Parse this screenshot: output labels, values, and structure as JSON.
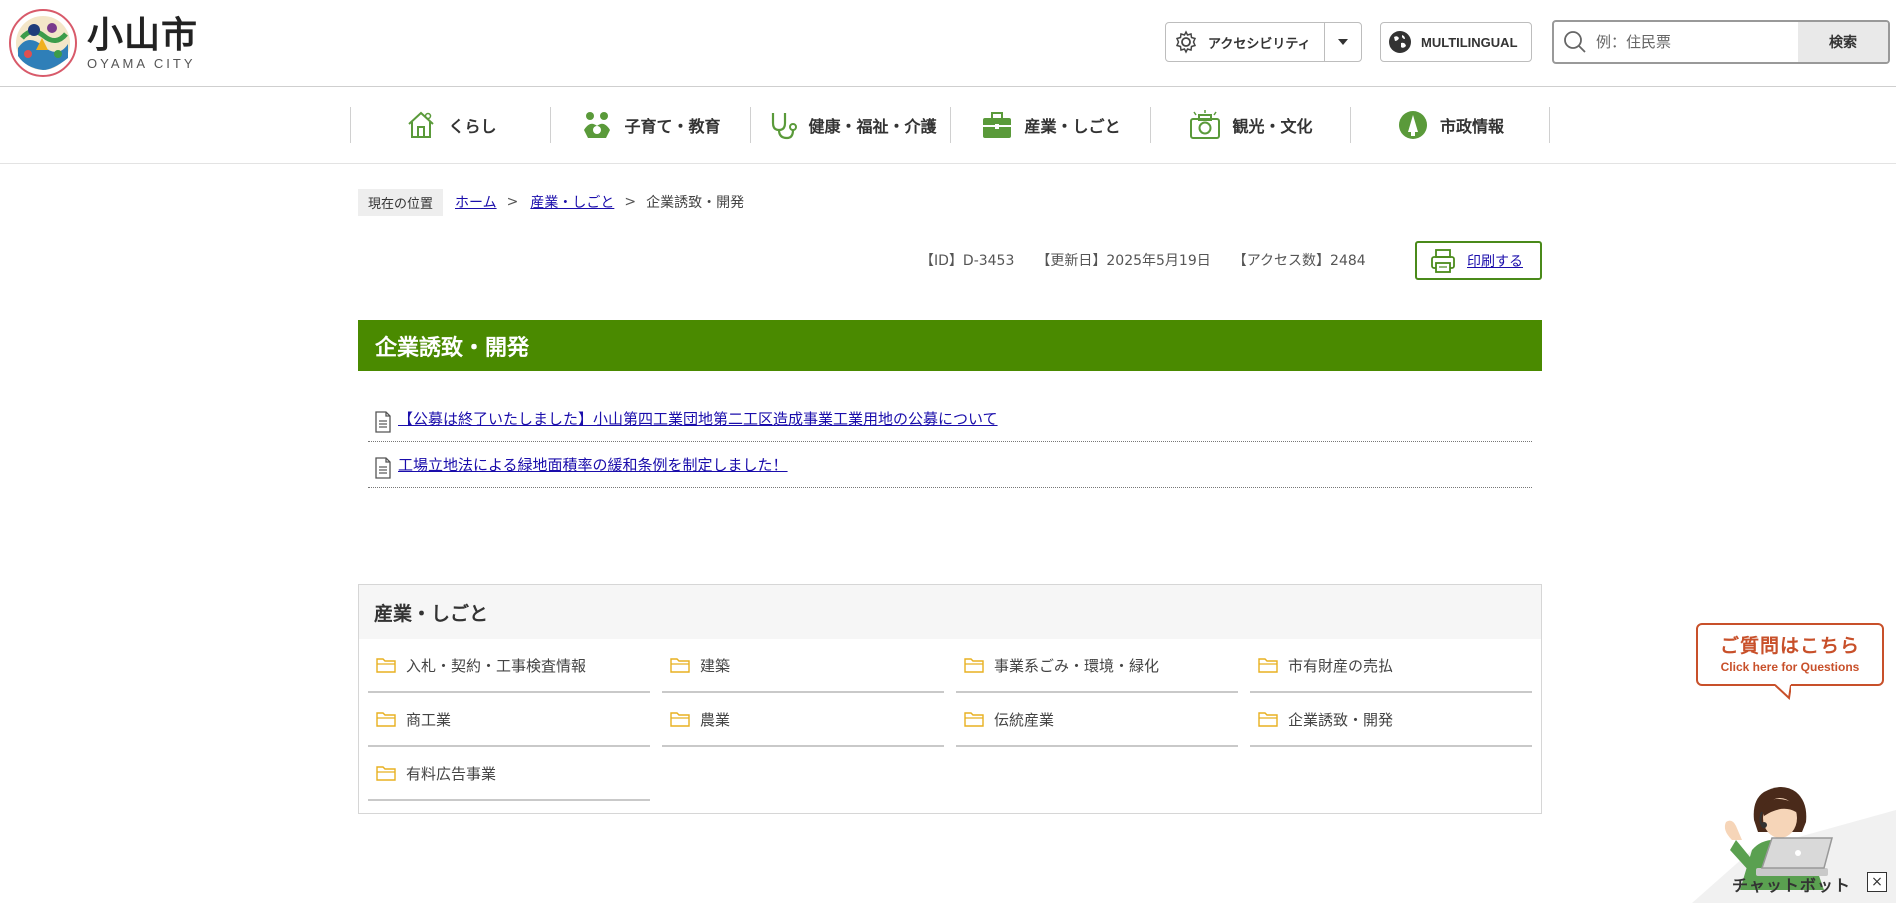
{
  "header": {
    "logo": {
      "jp": "小山市",
      "en": "OYAMA CITY"
    },
    "accessibility_label": "アクセシビリティ",
    "multilingual_label": "MULTILINGUAL",
    "search": {
      "placeholder": "例：住民票",
      "button": "検索"
    }
  },
  "gnav": [
    {
      "label": "くらし",
      "icon": "house-icon"
    },
    {
      "label": "子育て・教育",
      "icon": "family-icon"
    },
    {
      "label": "健康・福祉・介護",
      "icon": "stethoscope-icon"
    },
    {
      "label": "産業・しごと",
      "icon": "briefcase-icon"
    },
    {
      "label": "観光・文化",
      "icon": "camera-icon"
    },
    {
      "label": "市政情報",
      "icon": "city-hall-icon"
    }
  ],
  "breadcrumb": {
    "tag": "現在の位置",
    "home": "ホーム",
    "parent": "産業・しごと",
    "current": "企業誘致・開発",
    "separator": ">"
  },
  "meta": {
    "id": "【ID】D-3453",
    "updated": "【更新日】2025年5月19日",
    "access": "【アクセス数】2484",
    "print_label": "印刷する"
  },
  "page_title": "企業誘致・開発",
  "links": [
    "【公募は終了いたしました】小山第四工業団地第二工区造成事業工業用地の公募について",
    "工場立地法による緑地面積率の緩和条例を制定しました！"
  ],
  "category": {
    "title": "産業・しごと",
    "items": [
      "入札・契約・工事検査情報",
      "建築",
      "事業系ごみ・環境・緑化",
      "市有財産の売払",
      "商工業",
      "農業",
      "伝統産業",
      "企業誘致・開発",
      "有料広告事業"
    ]
  },
  "chatbot": {
    "bubble_jp": "ご質問はこちら",
    "bubble_en": "Click here for Questions",
    "label": "チャットボット",
    "close": "×"
  },
  "colors": {
    "title_bar": "#4a8a00",
    "accent_green": "#4a8a1a",
    "link": "#1a0dab",
    "chat_accent": "#c8502a"
  }
}
